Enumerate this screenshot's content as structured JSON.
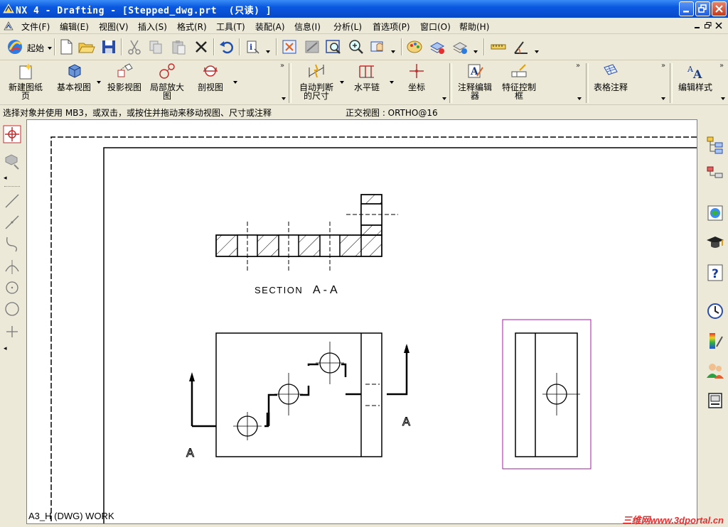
{
  "window": {
    "title": "NX 4 - Drafting - [Stepped_dwg.prt  (只读) ]"
  },
  "menubar": {
    "items": [
      "文件(F)",
      "编辑(E)",
      "视图(V)",
      "插入(S)",
      "格式(R)",
      "工具(T)",
      "装配(A)",
      "信息(I)",
      "分析(L)",
      "首选项(P)",
      "窗口(O)",
      "帮助(H)"
    ]
  },
  "toolbar1": {
    "start_label": "起始",
    "icons": [
      "new-file-icon",
      "open-folder-icon",
      "save-icon",
      "cut-icon",
      "copy-icon",
      "paste-icon",
      "delete-icon",
      "undo-icon",
      "info-icon",
      "fit-icon",
      "zoom-icon",
      "zoom-in-icon",
      "pan-icon",
      "color-palette-icon",
      "layer-settings-icon",
      "layer-visible-icon",
      "measure-distance-icon",
      "measure-angle-icon"
    ]
  },
  "toolbar2": {
    "new_sheet": "新建图纸\n页",
    "base_view": "基本视图",
    "projected_view": "投影视图",
    "detail_view": "局部放大\n图",
    "section_view": "剖视图",
    "inferred_dimension": "自动判断\n的尺寸",
    "horizontal_chain": "水平链",
    "coordinate": "坐标",
    "annotation_editor": "注释编辑\n器",
    "feature_control_frame": "特征控制\n框",
    "tabular_note": "表格注释",
    "edit_style": "编辑样式"
  },
  "status": {
    "prompt": "选择对象并使用 MB3，或双击，或按住并拖动来移动视图、尺寸或注释",
    "view": "正交视图 : ORTHO@16"
  },
  "drawing": {
    "section_label": "SECTION",
    "section_letters": "A-A",
    "cut_label_left": "A",
    "cut_label_right": "A",
    "sheet_label": "A3_H (DWG) WORK"
  },
  "watermark": "三维网www.3dportal.cn",
  "colors": {
    "title_bar": "#0a58e0",
    "selection_border": "#a020a0",
    "canvas": "#ffffff"
  }
}
